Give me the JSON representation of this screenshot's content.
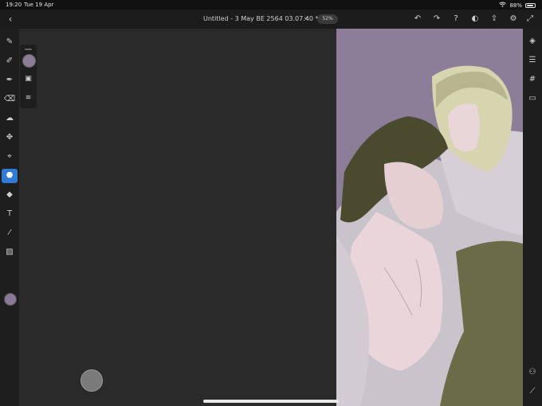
{
  "status": {
    "time": "19:20",
    "date": "Tue 19 Apr",
    "battery_text": "88%",
    "battery_level": 0.88,
    "wifi_icon": "wifi-icon"
  },
  "titlebar": {
    "back_icon": "chevron-left-icon",
    "doc_title": "Untitled - 3 May BE 2564 03.07.40 *",
    "title_chevron": "chevron-down-icon",
    "zoom_label": "52%"
  },
  "top_actions": [
    {
      "name": "undo-icon",
      "glyph": "↶"
    },
    {
      "name": "redo-icon",
      "glyph": "↷"
    },
    {
      "name": "help-icon",
      "glyph": "?"
    },
    {
      "name": "account-icon",
      "glyph": "◐"
    },
    {
      "name": "share-icon",
      "glyph": "⇪"
    },
    {
      "name": "settings-icon",
      "glyph": "⚙"
    }
  ],
  "expand_icon": "expand-icon",
  "left_tools": [
    {
      "name": "brush-tool-icon"
    },
    {
      "name": "pixel-brush-tool-icon"
    },
    {
      "name": "vector-brush-tool-icon"
    },
    {
      "name": "eraser-tool-icon"
    },
    {
      "name": "smudge-tool-icon"
    },
    {
      "name": "transform-tool-icon"
    },
    {
      "name": "lasso-tool-icon"
    },
    {
      "name": "fill-tool-icon",
      "active": true
    },
    {
      "name": "shape-tool-icon"
    },
    {
      "name": "text-tool-icon",
      "glyph": "T"
    },
    {
      "name": "eyedropper-tool-icon"
    },
    {
      "name": "image-tool-icon"
    }
  ],
  "color_swatch": "#897896",
  "sub_panel": {
    "brush_color": "#8c7d98",
    "items": [
      {
        "name": "fill-mode-icon"
      },
      {
        "name": "fill-settings-icon"
      }
    ]
  },
  "right_tools": [
    {
      "name": "layers-icon",
      "glyph": "◈"
    },
    {
      "name": "adjustments-icon",
      "glyph": "☰"
    },
    {
      "name": "grid-icon",
      "glyph": "#"
    },
    {
      "name": "comment-icon",
      "glyph": "▭"
    }
  ],
  "right_bottom_tools": [
    {
      "name": "shapes-icon",
      "glyph": "⚇"
    },
    {
      "name": "ruler-icon",
      "glyph": "⟋"
    }
  ],
  "canvas": {
    "bg": "#8c7d98"
  }
}
